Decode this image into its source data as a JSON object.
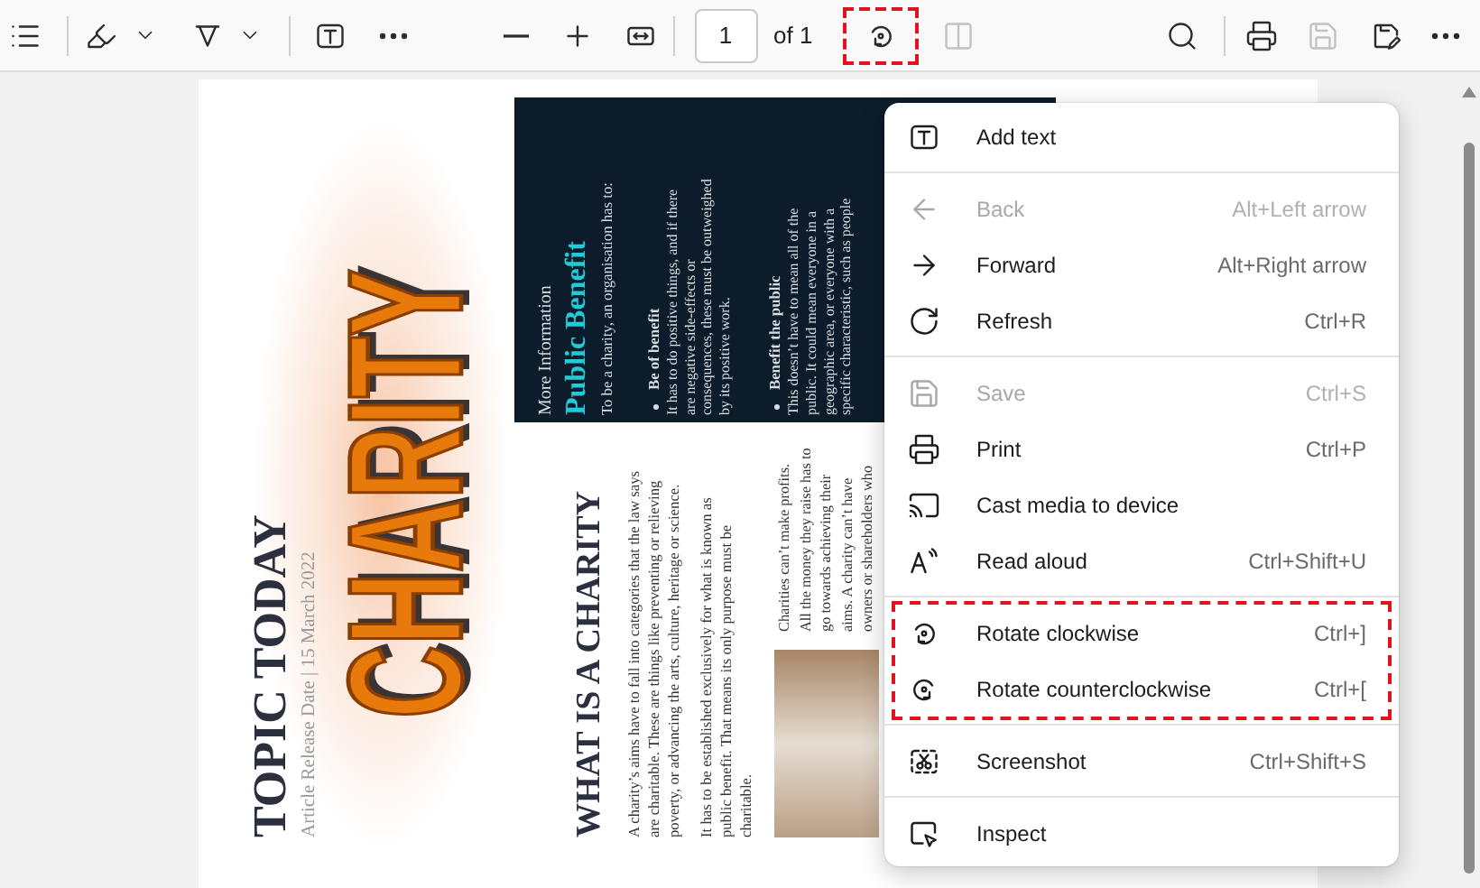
{
  "toolbar": {
    "buttons": [
      {
        "disabled": false,
        "highlighted": false
      },
      {
        "disabled": false,
        "highlighted": false
      },
      {
        "disabled": false,
        "highlighted": false
      },
      {
        "disabled": false,
        "highlighted": false
      },
      {
        "disabled": false,
        "highlighted": false
      },
      {
        "disabled": false,
        "highlighted": false
      },
      {
        "disabled": false,
        "highlighted": false
      },
      {
        "disabled": false,
        "highlighted": false
      },
      {
        "disabled": false,
        "highlighted": false
      },
      {
        "disabled": false,
        "highlighted": false
      },
      {
        "disabled": false,
        "highlighted": true
      },
      {
        "disabled": true,
        "highlighted": false
      },
      {
        "disabled": false,
        "highlighted": false
      },
      {
        "disabled": false,
        "highlighted": false
      },
      {
        "disabled": true,
        "highlighted": false
      },
      {
        "disabled": false,
        "highlighted": false
      },
      {
        "disabled": false,
        "highlighted": false
      }
    ],
    "page_field": {
      "value": "1"
    },
    "page_total": "of 1"
  },
  "document": {
    "title": "TOPIC TODAY",
    "release": "Article Release Date | 15 March 2022",
    "banner": "CHARITY",
    "article": {
      "heading": "WHAT IS A CHARITY",
      "paragraphs": [
        [
          "A charity’s aims have to fall into categories that the law says",
          "are charitable. These are things like preventing or relieving",
          "poverty, or advancing the arts, culture, heritage or science."
        ],
        [
          "It has to be established exclusively for what is known as",
          "public benefit. That means its only purpose must be",
          "charitable."
        ]
      ]
    },
    "aside": [
      "Charities can’t make profits.",
      "All the money they raise has to",
      "go towards achieving their",
      "aims. A charity can’t have",
      "owners or shareholders who"
    ],
    "info_box": {
      "kicker": "More Information",
      "title": "Public Benefit",
      "intro": "To be a charity, an organisation has to:",
      "points": [
        {
          "title": "Be of benefit",
          "lines": [
            "It has to do positive things, and if there",
            "are negative side-effects or",
            "consequences, these must be outweighed",
            "by its positive work."
          ]
        },
        {
          "title": "Benefit the public",
          "lines": [
            "This doesn’t have to mean all of the",
            "public. It could mean everyone in a",
            "geographic area, or everyone with a",
            "specific characteristic, such as people"
          ]
        }
      ]
    }
  },
  "context_menu": {
    "sections": [
      {
        "highlighted": false,
        "items": [
          {
            "label": "Add text",
            "disabled": false
          }
        ]
      },
      {
        "highlighted": false,
        "items": [
          {
            "label": "Back",
            "shortcut": "Alt+Left arrow",
            "disabled": true
          },
          {
            "label": "Forward",
            "shortcut": "Alt+Right arrow",
            "disabled": false
          },
          {
            "label": "Refresh",
            "shortcut": "Ctrl+R",
            "disabled": false
          }
        ]
      },
      {
        "highlighted": false,
        "items": [
          {
            "label": "Save",
            "shortcut": "Ctrl+S",
            "disabled": true
          },
          {
            "label": "Print",
            "shortcut": "Ctrl+P",
            "disabled": false
          },
          {
            "label": "Cast media to device",
            "disabled": false
          },
          {
            "label": "Read aloud",
            "shortcut": "Ctrl+Shift+U",
            "disabled": false
          }
        ]
      },
      {
        "highlighted": true,
        "items": [
          {
            "label": "Rotate clockwise",
            "shortcut": "Ctrl+]",
            "disabled": false
          },
          {
            "label": "Rotate counterclockwise",
            "shortcut": "Ctrl+[",
            "disabled": false
          }
        ]
      },
      {
        "highlighted": false,
        "items": [
          {
            "label": "Screenshot",
            "shortcut": "Ctrl+Shift+S",
            "disabled": false
          }
        ]
      },
      {
        "highlighted": false,
        "items": [
          {
            "label": "Inspect",
            "disabled": false
          }
        ]
      }
    ]
  }
}
